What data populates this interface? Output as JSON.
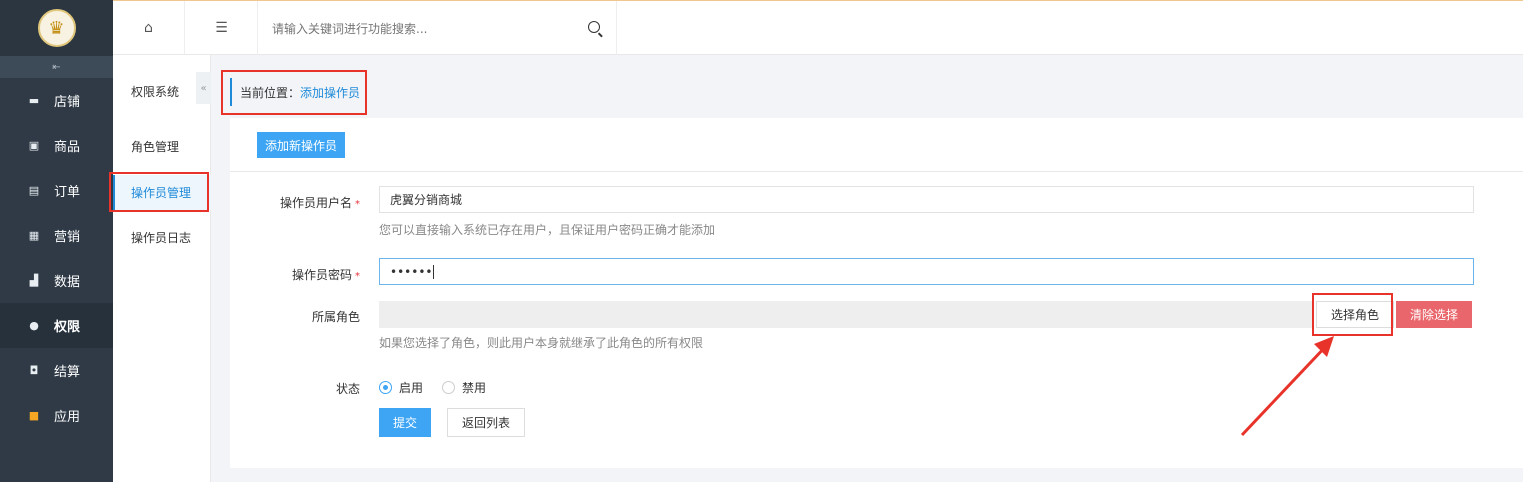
{
  "sidebar": {
    "items": [
      {
        "label": "店铺",
        "icon": "store-icon"
      },
      {
        "label": "商品",
        "icon": "goods-icon"
      },
      {
        "label": "订单",
        "icon": "order-icon"
      },
      {
        "label": "营销",
        "icon": "marketing-icon"
      },
      {
        "label": "数据",
        "icon": "data-icon"
      },
      {
        "label": "权限",
        "icon": "permission-icon"
      },
      {
        "label": "结算",
        "icon": "settlement-icon"
      },
      {
        "label": "应用",
        "icon": "apps-icon"
      }
    ],
    "active_index": 5
  },
  "topbar": {
    "search_placeholder": "请输入关键词进行功能搜索..."
  },
  "submenu": {
    "title": "权限系统",
    "items": [
      {
        "label": "角色管理"
      },
      {
        "label": "操作员管理"
      },
      {
        "label": "操作员日志"
      }
    ],
    "active_index": 1
  },
  "breadcrumb": {
    "prefix": "当前位置：",
    "current": "添加操作员"
  },
  "form": {
    "tab_label": "添加新操作员",
    "username_label": "操作员用户名",
    "username_value": "虎翼分销商城",
    "username_hint": "您可以直接输入系统已存在用户，且保证用户密码正确才能添加",
    "password_label": "操作员密码",
    "password_value": "••••••",
    "role_label": "所属角色",
    "select_role_label": "选择角色",
    "clear_role_label": "清除选择",
    "role_hint": "如果您选择了角色，则此用户本身就继承了此角色的所有权限",
    "status_label": "状态",
    "status_enabled": "启用",
    "status_disabled": "禁用",
    "status_value": "启用",
    "submit_label": "提交",
    "back_label": "返回列表",
    "required_mark": "*"
  },
  "colors": {
    "accent": "#3da5f4",
    "sidebar_bg": "#2f3a46",
    "danger": "#e9676c",
    "annotation": "#e8332a"
  }
}
